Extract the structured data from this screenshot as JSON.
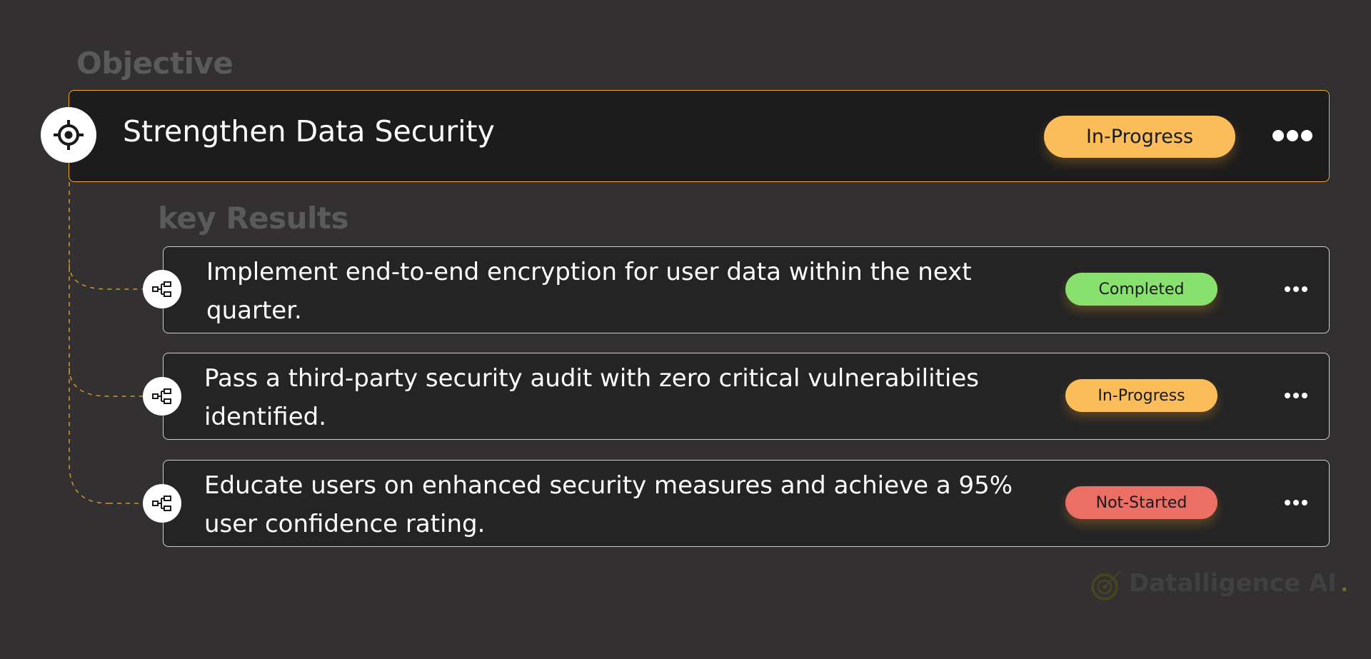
{
  "objective": {
    "section_label": "Objective",
    "title": "Strengthen Data Security",
    "icon": "target-icon",
    "status": "In-Progress",
    "status_color": "#fbbd5a",
    "border_color": "#f0a928"
  },
  "key_results": {
    "section_label": "key Results",
    "items": [
      {
        "text": "Implement end-to-end encryption for user data within the next quarter.",
        "status": "Completed",
        "status_color": "#88e06e",
        "icon": "hierarchy-icon"
      },
      {
        "text": "Pass a third-party security audit with zero critical vulnerabilities identified.",
        "status": "In-Progress",
        "status_color": "#fbbd5a",
        "icon": "hierarchy-icon"
      },
      {
        "text": "Educate users on enhanced security measures and achieve a 95% user confidence rating.",
        "status": "Not-Started",
        "status_color": "#ec6f66",
        "icon": "hierarchy-icon"
      }
    ]
  },
  "watermark": {
    "brand": "Datalligence AI",
    "dot": "."
  }
}
